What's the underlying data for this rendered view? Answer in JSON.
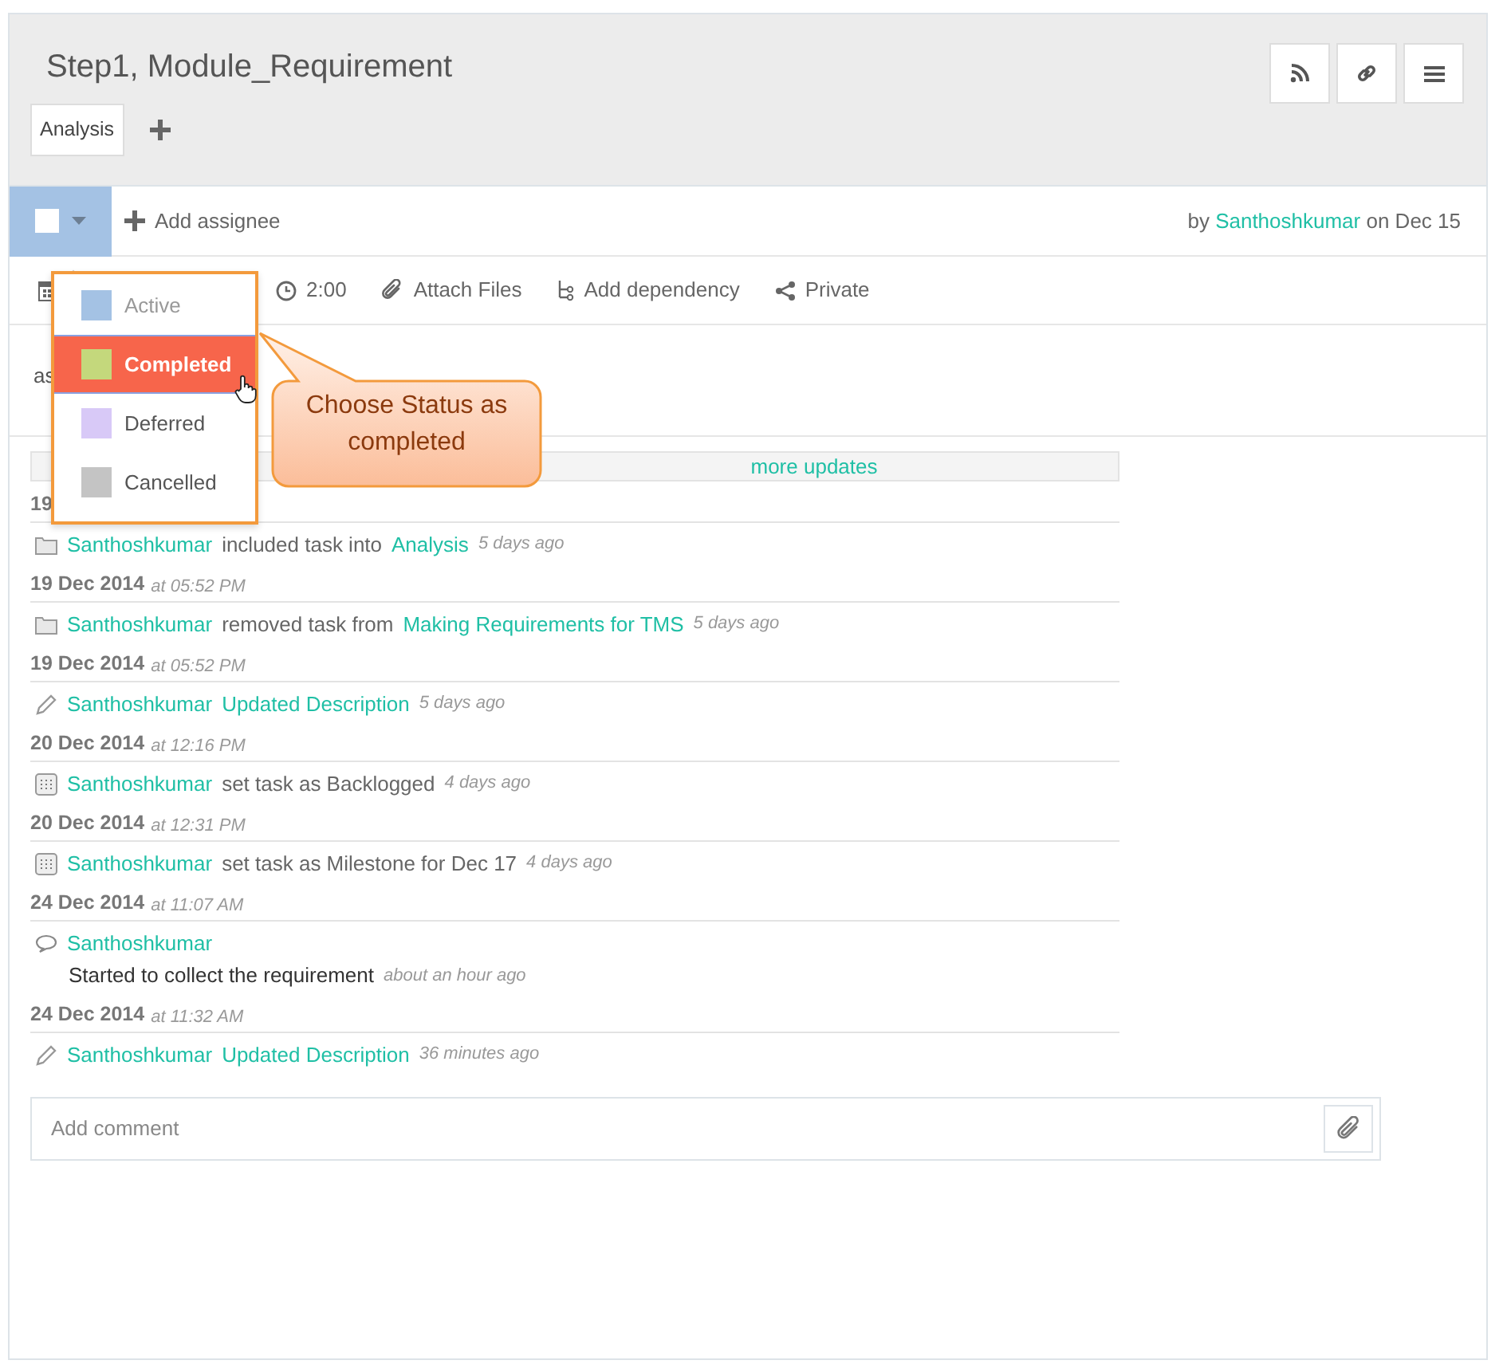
{
  "task": {
    "title": "Step1, Module_Requirement",
    "tags": [
      "Analysis"
    ]
  },
  "assignee_bar": {
    "status_checked": false,
    "add_assignee": "Add assignee",
    "by": "by",
    "author": "Santhoshkumar",
    "on": "on Dec 15"
  },
  "toolbar": [
    {
      "kind": "calendar"
    },
    {
      "kind": "time",
      "label": "2:00"
    },
    {
      "kind": "attach",
      "label": "Attach Files"
    },
    {
      "kind": "dependency",
      "label": "Add dependency"
    },
    {
      "kind": "privacy",
      "label": "Private"
    }
  ],
  "description": "as",
  "more_updates": "more updates",
  "activity": [
    {
      "date": "19",
      "kind": "folder",
      "parts": [
        {
          "kind": "link",
          "text": "Santhoshkumar"
        },
        {
          "kind": "plain",
          "text": "included task into"
        },
        {
          "kind": "link",
          "text": "Analysis"
        }
      ],
      "ago": "5 days ago"
    },
    {
      "date": "19 Dec 2014",
      "time": "at 05:52 PM",
      "kind": "folder",
      "parts": [
        {
          "kind": "link",
          "text": "Santhoshkumar"
        },
        {
          "kind": "plain",
          "text": "removed task from"
        },
        {
          "kind": "link",
          "text": "Making Requirements for TMS"
        }
      ],
      "ago": "5 days ago"
    },
    {
      "date": "19 Dec 2014",
      "time": "at 05:52 PM",
      "kind": "pencil",
      "parts": [
        {
          "kind": "link",
          "text": "Santhoshkumar"
        },
        {
          "kind": "link",
          "text": "Updated Description"
        }
      ],
      "ago": "5 days ago"
    },
    {
      "date": "20 Dec 2014",
      "time": "at 12:16 PM",
      "kind": "grid",
      "parts": [
        {
          "kind": "link",
          "text": "Santhoshkumar"
        },
        {
          "kind": "plain",
          "text": "set task as Backlogged"
        }
      ],
      "ago": "4 days ago"
    },
    {
      "date": "20 Dec 2014",
      "time": "at 12:31 PM",
      "kind": "grid",
      "parts": [
        {
          "kind": "link",
          "text": "Santhoshkumar"
        },
        {
          "kind": "plain",
          "text": "set task as Milestone for Dec 17"
        }
      ],
      "ago": "4 days ago"
    },
    {
      "date": "24 Dec 2014",
      "time": "at 11:07 AM",
      "kind": "comment",
      "parts": [
        {
          "kind": "link",
          "text": "Santhoshkumar"
        }
      ],
      "body": "Started to collect the requirement",
      "ago": "about an hour ago"
    },
    {
      "date": "24 Dec 2014",
      "time": "at 11:32 AM",
      "kind": "pencil",
      "parts": [
        {
          "kind": "link",
          "text": "Santhoshkumar"
        },
        {
          "kind": "link",
          "text": "Updated Description"
        }
      ],
      "ago": "36 minutes ago"
    }
  ],
  "comment": {
    "placeholder": "Add comment"
  },
  "status_menu": [
    {
      "label": "Active",
      "color": "#a4c2e4",
      "selected": false,
      "disabled": true
    },
    {
      "label": "Completed",
      "color": "#c4d87c",
      "selected": true,
      "disabled": false
    },
    {
      "label": "Deferred",
      "color": "#d8c9f7",
      "selected": false,
      "disabled": false
    },
    {
      "label": "Cancelled",
      "color": "#c4c4c4",
      "selected": false,
      "disabled": false
    }
  ],
  "callout": {
    "text": "Choose Status as completed"
  }
}
